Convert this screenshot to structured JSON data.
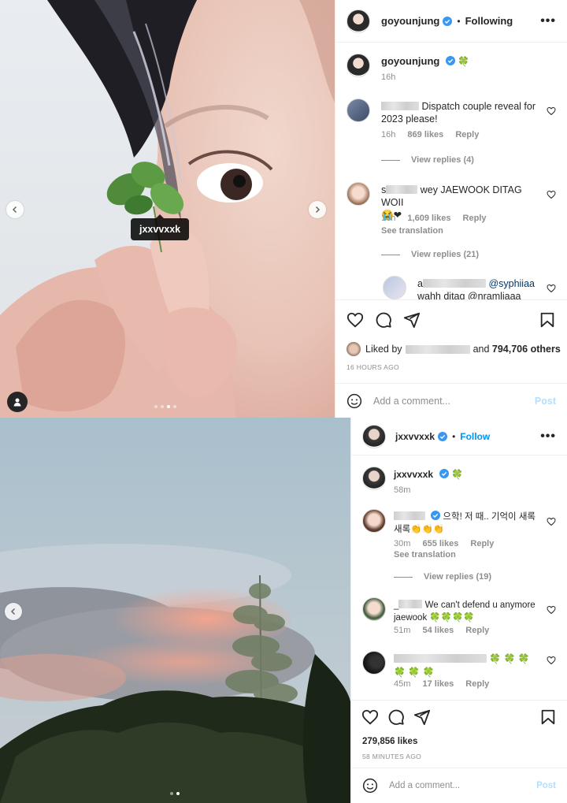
{
  "post1": {
    "header": {
      "username": "goyounjung",
      "follow_label": "Following",
      "more": "•••"
    },
    "caption": {
      "username": "goyounjung",
      "emoji": "🍀",
      "time": "16h"
    },
    "comments": [
      {
        "text": "Dispatch couple reveal for 2023 please!",
        "time": "16h",
        "likes": "869 likes",
        "reply": "Reply",
        "view_replies": "View replies (4)"
      },
      {
        "user_prefix": "s",
        "text": "wey JAEWOOK DITAG WOII",
        "emoji": "😭❤",
        "time": "16h",
        "likes": "1,609 likes",
        "reply": "Reply",
        "see_translation": "See translation",
        "view_replies": "View replies (21)"
      }
    ],
    "reply_preview": {
      "user_prefix": "a",
      "mention": "@syphiiaa",
      "text": "wahh ditag @nramliaaa"
    },
    "likes": {
      "prefix": "Liked by",
      "mid": "and",
      "count": "794,706 others"
    },
    "time_ago": "16 HOURS AGO",
    "add_comment_placeholder": "Add a comment...",
    "post_label": "Post",
    "tag": "jxxvvxxk"
  },
  "post2": {
    "header": {
      "username": "jxxvvxxk",
      "follow_label": "Follow",
      "more": "•••"
    },
    "caption": {
      "username": "jxxvvxxk",
      "emoji": "🍀",
      "time": "58m"
    },
    "comments": [
      {
        "text": "으학! 저 때.. 기억이 새록새록👏👏👏",
        "time": "30m",
        "likes": "655 likes",
        "reply": "Reply",
        "see_translation": "See translation",
        "view_replies": "View replies (19)"
      },
      {
        "user_prefix": "_",
        "text": "We can't defend u anymore jaewook 🍀🍀🍀🍀",
        "time": "51m",
        "likes": "54 likes",
        "reply": "Reply"
      },
      {
        "text": "🍀 🍀 🍀 🍀 🍀 🍀",
        "time": "45m",
        "likes": "17 likes",
        "reply": "Reply"
      }
    ],
    "likes": {
      "count": "279,856 likes"
    },
    "time_ago": "58 MINUTES AGO",
    "add_comment_placeholder": "Add a comment...",
    "post_label": "Post"
  },
  "colors": {
    "accent": "#0095f6",
    "verified": "#3897f0",
    "heart_red": "#ed4956",
    "muted": "#8e8e8e"
  }
}
